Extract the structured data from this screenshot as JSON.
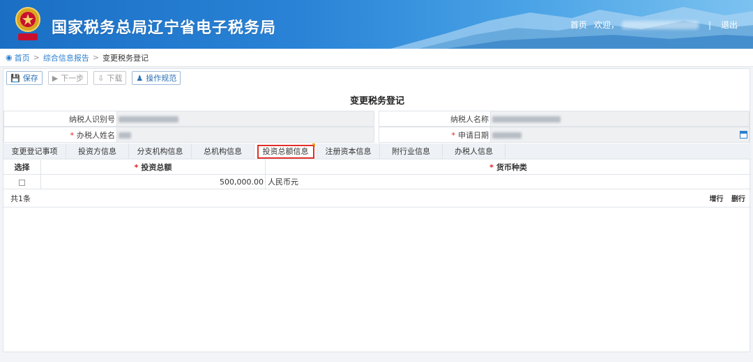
{
  "header": {
    "site_title": "国家税务总局辽宁省电子税务局",
    "nav_home": "首页",
    "nav_welcome": "欢迎，",
    "nav_separator": "|",
    "nav_logout": "退出"
  },
  "breadcrumb": {
    "home": "首页",
    "section": "综合信息报告",
    "current": "变更税务登记",
    "separator": ">"
  },
  "toolbar": {
    "save": "保存",
    "next": "下一步",
    "download": "下载",
    "guide": "操作规范"
  },
  "form": {
    "title": "变更税务登记",
    "taxpayer_id_label": "纳税人识别号",
    "taxpayer_name_label": "纳税人名称",
    "handler_name_label": "办税人姓名",
    "apply_date_label": "申请日期",
    "required_mark": "*"
  },
  "tabs": [
    {
      "label": "变更登记事项"
    },
    {
      "label": "投资方信息"
    },
    {
      "label": "分支机构信息"
    },
    {
      "label": "总机构信息"
    },
    {
      "label": "投资总额信息"
    },
    {
      "label": "注册资本信息"
    },
    {
      "label": "附行业信息"
    },
    {
      "label": "办税人信息"
    }
  ],
  "grid": {
    "col_select": "选择",
    "col_amount": "投资总额",
    "col_currency": "货币种类",
    "rows": [
      {
        "amount": "500,000.00",
        "currency": "人民币元"
      }
    ],
    "total": "共1条",
    "add_row": "增行",
    "delete_row": "删行"
  },
  "colors": {
    "header_blue": "#1a6fc4",
    "link_blue": "#2a7fd0",
    "required_red": "#e02020",
    "active_tab_border": "#e0302a"
  }
}
